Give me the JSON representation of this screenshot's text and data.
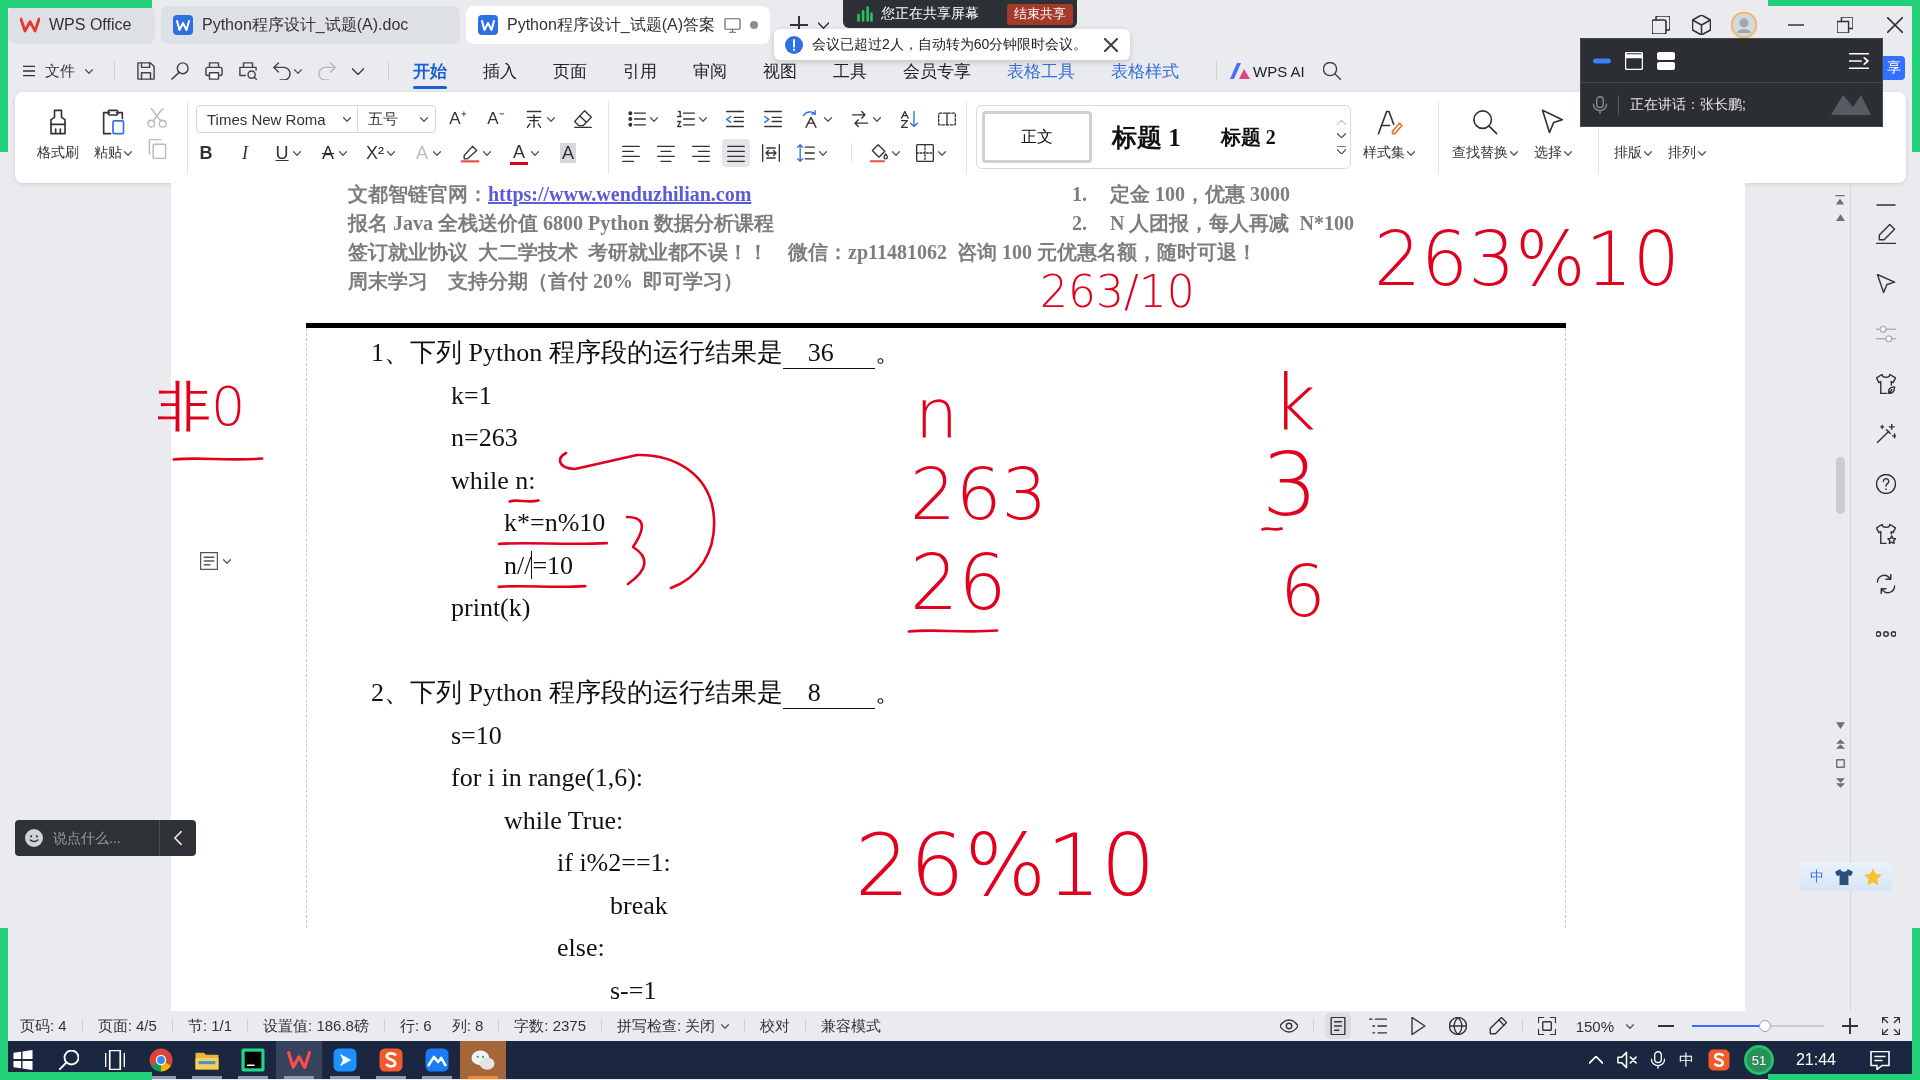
{
  "title_bar": {
    "tabs": [
      {
        "kind": "home",
        "label": "WPS Office",
        "selected": false
      },
      {
        "kind": "document",
        "label": "Python程序设计_试题(A).doc",
        "selected": false
      },
      {
        "kind": "document",
        "label": "Python程序设计_试题(A)答案",
        "selected": true
      }
    ]
  },
  "share_banner": {
    "text": "您正在共享屏幕",
    "button": "结束共享"
  },
  "notification": {
    "text": "会议已超过2人，自动转为60分钟限时会议。"
  },
  "menu": {
    "file": "文件",
    "quick": [
      {
        "kind": "save",
        "dropdown": false,
        "disabled": false
      },
      {
        "kind": "lens",
        "dropdown": false,
        "disabled": false
      },
      {
        "kind": "print",
        "dropdown": false,
        "disabled": false
      },
      {
        "kind": "preview",
        "dropdown": false,
        "disabled": false
      },
      {
        "kind": "undo",
        "dropdown": true,
        "disabled": false
      },
      {
        "kind": "redo",
        "dropdown": false,
        "disabled": true
      },
      {
        "kind": "more",
        "dropdown": false,
        "disabled": false
      }
    ],
    "tabs": [
      {
        "label": "开始",
        "kind": "main",
        "selected": true
      },
      {
        "label": "插入",
        "kind": "main",
        "selected": false
      },
      {
        "label": "页面",
        "kind": "main",
        "selected": false
      },
      {
        "label": "引用",
        "kind": "main",
        "selected": false
      },
      {
        "label": "审阅",
        "kind": "main",
        "selected": false
      },
      {
        "label": "视图",
        "kind": "main",
        "selected": false
      },
      {
        "label": "工具",
        "kind": "main",
        "selected": false
      },
      {
        "label": "会员专享",
        "kind": "main",
        "selected": false
      },
      {
        "label": "表格工具",
        "kind": "context",
        "selected": false
      },
      {
        "label": "表格样式",
        "kind": "context",
        "selected": false
      }
    ],
    "ai": "WPS AI",
    "share": "享"
  },
  "meeting_panel": {
    "speaker": "正在讲话：张长鹏;"
  },
  "ribbon": {
    "clipboard": [
      {
        "kind": "format-painter",
        "label": "格式刷",
        "dropdown": false
      },
      {
        "kind": "paste",
        "label": "粘贴",
        "dropdown": true
      }
    ],
    "clipboard_small": [
      {
        "kind": "cut",
        "disabled": true
      },
      {
        "kind": "copy",
        "disabled": true
      }
    ],
    "font": {
      "name": "Times New Roma",
      "size": "五号"
    },
    "font_row1": [
      {
        "kind": "grow",
        "text": "A⁺",
        "dropdown": false
      },
      {
        "kind": "shrink",
        "text": "A⁻",
        "dropdown": false
      },
      {
        "kind": "phonetic",
        "dropdown": true
      },
      {
        "kind": "clear-format",
        "dropdown": false
      }
    ],
    "font_row2": [
      {
        "kind": "bold",
        "text": "B",
        "dropdown": false,
        "disabled": false
      },
      {
        "kind": "italic",
        "text": "I",
        "dropdown": false,
        "disabled": false
      },
      {
        "kind": "underline",
        "text": "U",
        "dropdown": true,
        "disabled": false
      },
      {
        "kind": "strikethrough",
        "text": "A",
        "dropdown": true,
        "disabled": false
      },
      {
        "kind": "superscript",
        "text": "X²",
        "dropdown": true,
        "disabled": false
      },
      {
        "kind": "text-effect",
        "text": "A",
        "dropdown": true,
        "disabled": true
      },
      {
        "kind": "highlight",
        "dropdown": true,
        "disabled": false
      },
      {
        "kind": "font-color",
        "text": "A",
        "dropdown": true,
        "disabled": false,
        "color": "#d9001b"
      },
      {
        "kind": "char-shading",
        "text": "A",
        "dropdown": false,
        "disabled": false
      }
    ],
    "para_row1": [
      {
        "kind": "bullets",
        "dropdown": true
      },
      {
        "kind": "numbering",
        "dropdown": true
      },
      {
        "kind": "indent-decrease",
        "dropdown": false
      },
      {
        "kind": "indent-increase",
        "dropdown": false
      },
      {
        "kind": "text-direction",
        "dropdown": true
      },
      {
        "kind": "convert",
        "dropdown": true
      },
      {
        "kind": "sort",
        "dropdown": false
      },
      {
        "kind": "columns",
        "dropdown": false
      }
    ],
    "para_row2": [
      {
        "kind": "align-left",
        "dropdown": false,
        "selected": false
      },
      {
        "kind": "align-center",
        "dropdown": false,
        "selected": false
      },
      {
        "kind": "align-right",
        "dropdown": false,
        "selected": false
      },
      {
        "kind": "justify",
        "dropdown": false,
        "selected": true
      },
      {
        "kind": "distribute",
        "dropdown": false,
        "selected": false
      },
      {
        "kind": "line-spacing",
        "dropdown": true,
        "selected": false
      },
      {
        "kind": "shading",
        "dropdown": true,
        "selected": false
      },
      {
        "kind": "borders",
        "dropdown": true,
        "selected": false
      }
    ],
    "styles": [
      {
        "kind": "body",
        "label": "正文",
        "selected": true
      },
      {
        "kind": "heading1",
        "label": "标题 1",
        "selected": false
      },
      {
        "kind": "heading2",
        "label": "标题 2",
        "selected": false
      }
    ],
    "tools": [
      {
        "kind": "style-set",
        "label": "样式集",
        "dropdown": true
      },
      {
        "kind": "find",
        "label": "查找替换",
        "dropdown": true
      },
      {
        "kind": "select",
        "label": "选择",
        "dropdown": true
      },
      {
        "kind": "layout",
        "label": "排版",
        "dropdown": true
      },
      {
        "kind": "arrange",
        "label": "排列",
        "dropdown": true
      }
    ]
  },
  "document": {
    "header": {
      "lines": [
        {
          "text": "文都智链官网：",
          "link": "https://www.wenduzhilian.com"
        },
        {
          "text": "报名 Java 全栈送价值 6800 Python 数据分析课程"
        },
        {
          "text": "签订就业协议  大二学技术  考研就业都不误！！    微信：zp11481062  咨询 100 元优惠名额，随时可退！"
        },
        {
          "text": "周末学习    支持分期（首付 20%  即可学习）"
        }
      ],
      "list": [
        {
          "marker": "1.",
          "text": "定金 100，优惠 3000"
        },
        {
          "marker": "2.",
          "text": "N 人团报，每人再减  N*100"
        }
      ]
    },
    "questions": [
      {
        "prompt": "1、下列 Python 程序段的运行结果是",
        "answer": "36",
        "end": "。",
        "code": [
          {
            "text": "k=1",
            "caret": false
          },
          {
            "text": "n=263",
            "caret": false
          },
          {
            "text": "while n:",
            "caret": false,
            "children": [
              {
                "text": "k*=n%10",
                "caret": false
              },
              {
                "text": "n//",
                "caret": true,
                "after_caret": "=10"
              }
            ]
          },
          {
            "text": "print(k)",
            "caret": false
          }
        ]
      },
      {
        "prompt": "2、下列 Python 程序段的运行结果是",
        "answer": "8",
        "end": "。",
        "code": [
          {
            "text": "s=10",
            "caret": false
          },
          {
            "text": "for i in range(1,6):",
            "caret": false,
            "children": [
              {
                "text": "while True:",
                "caret": false,
                "children": [
                  {
                    "text": "if i%2==1:",
                    "caret": false,
                    "children": [
                      {
                        "text": "break",
                        "caret": false
                      }
                    ]
                  },
                  {
                    "text": "else:",
                    "caret": false,
                    "children": [
                      {
                        "text": "s-=1",
                        "caret": false
                      }
                    ]
                  }
                ]
              }
            ]
          }
        ]
      }
    ]
  },
  "pen_notes": [
    {
      "text": "263/10"
    },
    {
      "text": "263%10"
    },
    {
      "text": "非0"
    },
    {
      "text": "n"
    },
    {
      "text": "263"
    },
    {
      "text": "26"
    },
    {
      "text": "k"
    },
    {
      "text": "3"
    },
    {
      "text": "6"
    },
    {
      "text": "26%10"
    }
  ],
  "pen_strokes": [
    {
      "kind": "loop-arrow"
    },
    {
      "kind": "brace"
    },
    {
      "kind": "underline"
    },
    {
      "kind": "underline"
    },
    {
      "kind": "underline"
    },
    {
      "kind": "underline"
    },
    {
      "kind": "underline"
    },
    {
      "kind": "underline"
    }
  ],
  "floating": {
    "chat": {
      "placeholder": "说点什么..."
    },
    "ime": {
      "label": "中"
    }
  },
  "sidebar": {
    "tools": [
      {
        "kind": "collapse",
        "disabled": false
      },
      {
        "kind": "pen",
        "disabled": false
      },
      {
        "kind": "pointer",
        "disabled": false
      },
      {
        "kind": "adjust",
        "disabled": true
      },
      {
        "kind": "theme",
        "disabled": false
      },
      {
        "kind": "magic",
        "disabled": false
      },
      {
        "kind": "help",
        "disabled": false
      },
      {
        "kind": "outfit",
        "disabled": false
      },
      {
        "kind": "translate",
        "disabled": false
      },
      {
        "kind": "more",
        "disabled": false
      }
    ]
  },
  "status_bar": {
    "groups": [
      [
        {
          "text": "页码: 4",
          "dropdown": false
        }
      ],
      [
        {
          "text": "页面: 4/5",
          "dropdown": false
        }
      ],
      [
        {
          "text": "节: 1/1",
          "dropdown": false
        }
      ],
      [
        {
          "text": "设置值: 186.8磅",
          "dropdown": false
        }
      ],
      [
        {
          "text": "行: 6",
          "dropdown": false
        },
        {
          "text": "列: 8",
          "dropdown": false
        }
      ],
      [
        {
          "text": "字数: 2375",
          "dropdown": false
        }
      ],
      [
        {
          "text": "拼写检查: 关闭",
          "dropdown": true
        }
      ],
      [
        {
          "text": "校对",
          "dropdown": false
        }
      ],
      [
        {
          "text": "兼容模式",
          "dropdown": false
        }
      ]
    ],
    "views": [
      [
        {
          "kind": "reading",
          "selected": false
        }
      ],
      [
        {
          "kind": "page",
          "selected": true
        },
        {
          "kind": "outline",
          "selected": false
        },
        {
          "kind": "play",
          "selected": false
        },
        {
          "kind": "web",
          "selected": false
        },
        {
          "kind": "pen",
          "selected": false
        }
      ],
      [
        {
          "kind": "fit",
          "selected": false
        }
      ]
    ],
    "zoom": {
      "text": "150%",
      "level": 0.55
    }
  },
  "taskbar": {
    "system": [
      {
        "kind": "start"
      },
      {
        "kind": "search"
      },
      {
        "kind": "task-view"
      }
    ],
    "apps": [
      {
        "kind": "browser",
        "running": true,
        "active": false,
        "flashing": false
      },
      {
        "kind": "folder",
        "running": true,
        "active": false,
        "flashing": false
      },
      {
        "kind": "ide",
        "running": true,
        "active": false,
        "flashing": false
      },
      {
        "kind": "office",
        "running": true,
        "active": true,
        "flashing": false
      },
      {
        "kind": "messenger",
        "running": true,
        "active": false,
        "flashing": false
      },
      {
        "kind": "input-method",
        "running": true,
        "active": false,
        "flashing": false
      },
      {
        "kind": "cloud",
        "running": true,
        "active": false,
        "flashing": false
      },
      {
        "kind": "chat",
        "running": true,
        "active": false,
        "flashing": true
      }
    ],
    "tray": {
      "ime": "中",
      "badge": "51",
      "time": "21:44"
    }
  }
}
